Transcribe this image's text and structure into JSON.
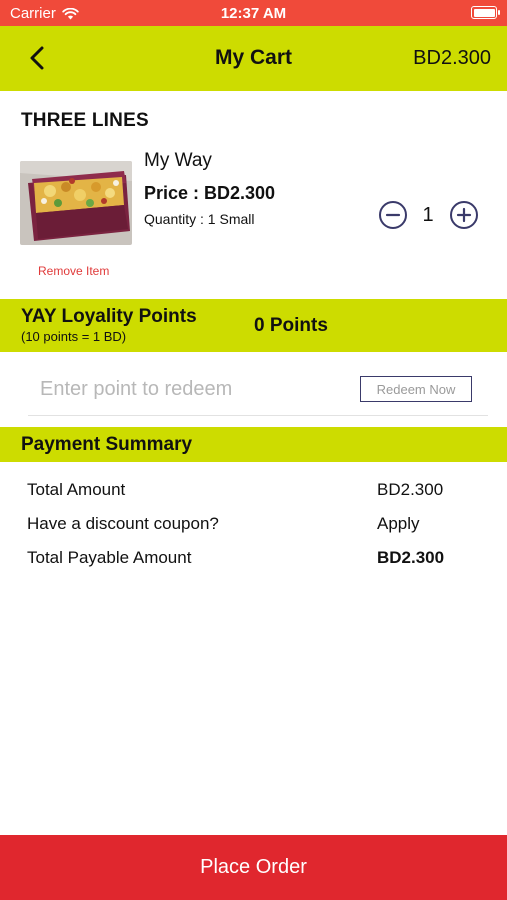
{
  "status_bar": {
    "carrier": "Carrier",
    "time": "12:37 AM"
  },
  "header": {
    "title": "My Cart",
    "total": "BD2.300"
  },
  "restaurant": {
    "name": "THREE LINES"
  },
  "cart_item": {
    "name": "My Way",
    "price": "Price : BD2.300",
    "quantity_text": "Quantity : 1 Small",
    "remove_label": "Remove Item",
    "stepper_value": "1"
  },
  "loyalty": {
    "title": "YAY Loyality Points",
    "subtitle": "(10 points = 1 BD)",
    "points": "0 Points",
    "input_placeholder": "Enter point to redeem",
    "redeem_label": "Redeem Now"
  },
  "summary": {
    "title": "Payment Summary",
    "rows": [
      {
        "label": "Total Amount",
        "value": "BD2.300"
      },
      {
        "label": "Have a discount coupon?",
        "value": "Apply"
      },
      {
        "label": "Total Payable Amount",
        "value": "BD2.300"
      }
    ]
  },
  "footer": {
    "place_order": "Place Order"
  },
  "colors": {
    "status_bar": "#f04a3a",
    "accent": "#cddc00",
    "place_order": "#e0272e",
    "remove": "#e03a3a",
    "stepper": "#3a3a6a"
  },
  "icons": {
    "back": "chevron-left-icon",
    "wifi": "wifi-icon",
    "battery": "battery-icon",
    "minus": "minus-circle-icon",
    "plus": "plus-circle-icon"
  }
}
